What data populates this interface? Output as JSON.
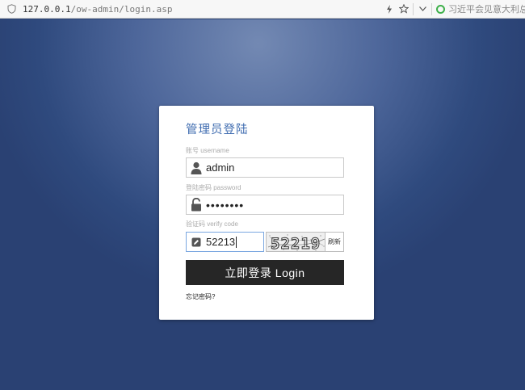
{
  "browser": {
    "url_host": "127.0.0.1",
    "url_path": "/ow-admin/login.asp",
    "search_text": "习近平会见意大利总理"
  },
  "login": {
    "title": "管理员登陆",
    "username": {
      "label": "账号 username",
      "value": "admin"
    },
    "password": {
      "label": "登陆密码 password",
      "value": "••••••••"
    },
    "verify": {
      "label": "验证码 verify code",
      "value": "52213",
      "captcha_text": "52219",
      "refresh_label": "刷新"
    },
    "submit_label": "立即登录 Login",
    "forgot_label": "忘记密码?"
  },
  "colors": {
    "title": "#3f6cb0",
    "button": "#262626",
    "background": "#2d4576"
  }
}
